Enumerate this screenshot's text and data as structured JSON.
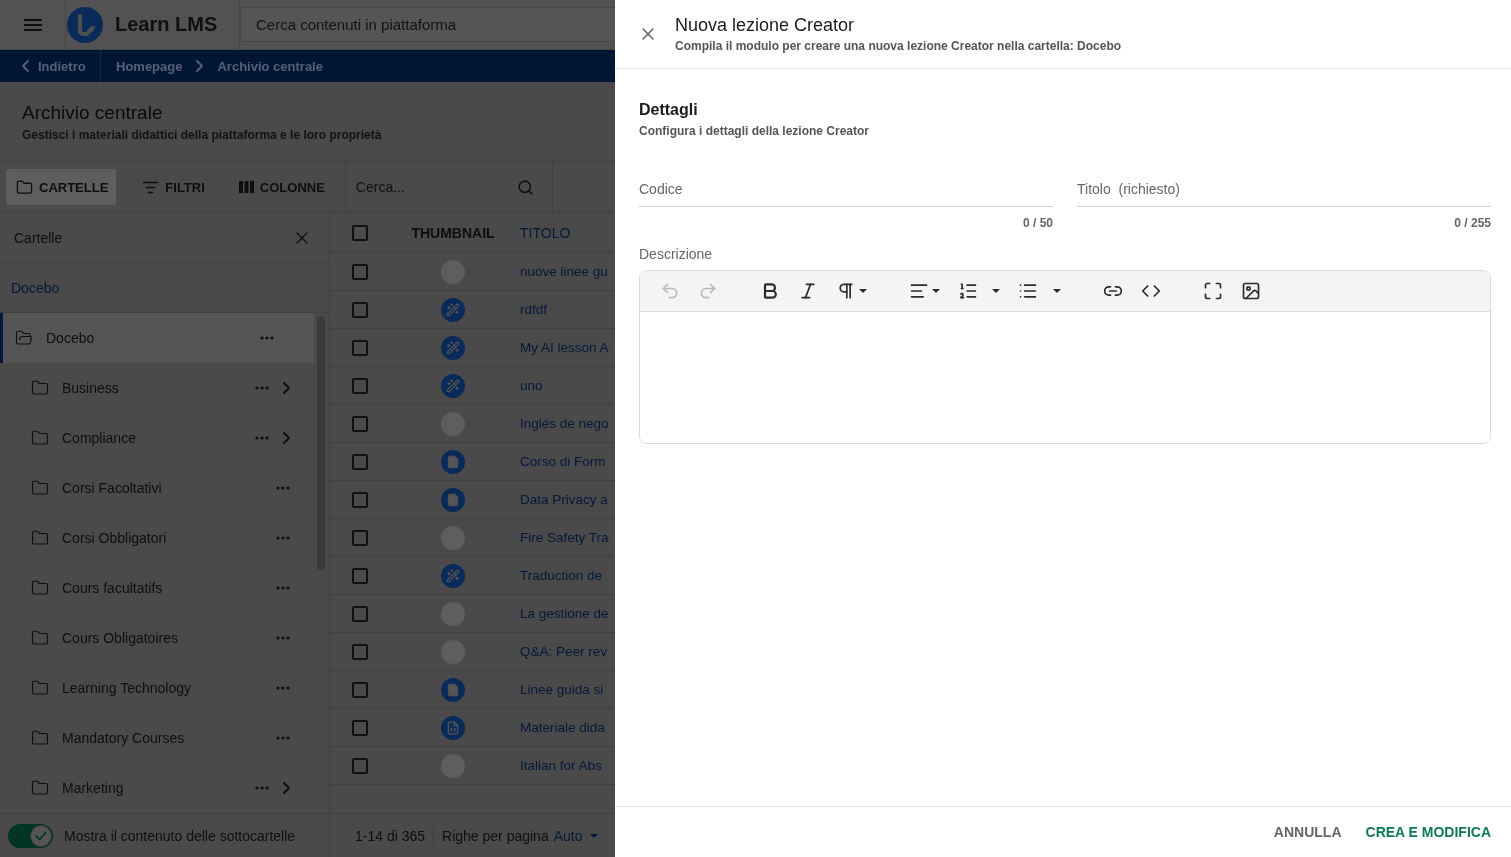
{
  "header": {
    "brand": "Learn LMS",
    "search": {
      "placeholder": "Cerca contenuti in piattaforma"
    }
  },
  "breadcrumb": {
    "back": "Indietro",
    "items": [
      "Homepage",
      "Archivio centrale"
    ]
  },
  "page": {
    "title": "Archivio centrale",
    "subtitle": "Gestisci i materiali didattici della piattaforma e le loro proprietà"
  },
  "toolbar": {
    "buttons": [
      {
        "kind": "folders",
        "label": "CARTELLE",
        "selected": true
      },
      {
        "kind": "filters",
        "label": "FILTRI",
        "selected": false
      },
      {
        "kind": "columns",
        "label": "COLONNE",
        "selected": false
      }
    ],
    "search": {
      "placeholder": "Cerca..."
    }
  },
  "folders": {
    "title": "Cartelle",
    "path": "Docebo",
    "tree": [
      {
        "name": "Docebo",
        "selected": true,
        "expanded": true,
        "children": [
          {
            "name": "Business",
            "selected": false,
            "expanded": false,
            "has_subfolders": true
          },
          {
            "name": "Compliance",
            "selected": false,
            "expanded": false,
            "has_subfolders": true
          },
          {
            "name": "Corsi Facoltativi",
            "selected": false,
            "expanded": false,
            "has_subfolders": false
          },
          {
            "name": "Corsi Obbligatori",
            "selected": false,
            "expanded": false,
            "has_subfolders": false
          },
          {
            "name": "Cours facultatifs",
            "selected": false,
            "expanded": false,
            "has_subfolders": false
          },
          {
            "name": "Cours Obligatoires",
            "selected": false,
            "expanded": false,
            "has_subfolders": false
          },
          {
            "name": "Learning Technology",
            "selected": false,
            "expanded": false,
            "has_subfolders": false
          },
          {
            "name": "Mandatory Courses",
            "selected": false,
            "expanded": false,
            "has_subfolders": false
          },
          {
            "name": "Marketing",
            "selected": false,
            "expanded": false,
            "has_subfolders": true
          }
        ]
      }
    ],
    "toggle": {
      "label": "Mostra il contenuto delle sottocartelle",
      "on": true
    }
  },
  "table": {
    "select_all": {
      "checked": false
    },
    "columns": [
      {
        "label": "THUMBNAIL",
        "sorted": false
      },
      {
        "label": "TITOLO",
        "sorted": true
      }
    ],
    "rows": [
      {
        "kind": "photo",
        "title": "nuove linee gu",
        "checked": false
      },
      {
        "kind": "ai",
        "title": "rdfdf",
        "checked": false
      },
      {
        "kind": "ai",
        "title": "My AI lesson A",
        "checked": false
      },
      {
        "kind": "ai",
        "title": "uno",
        "checked": false
      },
      {
        "kind": "photo",
        "title": "Inglés de nego",
        "checked": false
      },
      {
        "kind": "document",
        "title": "Corso di Form",
        "checked": false
      },
      {
        "kind": "document",
        "title": "Data Privacy a",
        "checked": false
      },
      {
        "kind": "photo",
        "title": "Fire Safety Tra",
        "checked": false
      },
      {
        "kind": "ai",
        "title": "Traduction de",
        "checked": false
      },
      {
        "kind": "photo",
        "title": "La gestione de",
        "checked": false
      },
      {
        "kind": "photo",
        "title": "Q&A: Peer rev",
        "checked": false
      },
      {
        "kind": "document",
        "title": "Linee guida si",
        "checked": false
      },
      {
        "kind": "code_document",
        "title": "Materiale dida",
        "checked": false
      },
      {
        "kind": "photo",
        "title": "Italian for Abs",
        "checked": false
      }
    ]
  },
  "pagination": {
    "range": "1-14 di 365",
    "rows_label": "Righe per pagina",
    "rows_value": "Auto"
  },
  "drawer": {
    "title": "Nuova lezione Creator",
    "subtitle": "Compila il modulo per creare una nuova lezione Creator nella cartella: Docebo",
    "section": {
      "title": "Dettagli",
      "subtitle": "Configura i dettagli della lezione Creator"
    },
    "fields": [
      {
        "label": "Codice",
        "counter": "0 / 50"
      },
      {
        "label": "Titolo",
        "note": "(richiesto)",
        "counter": "0 / 255"
      }
    ],
    "description": {
      "label": "Descrizione",
      "groups": [
        {
          "buttons": [
            {
              "kind": "undo",
              "disabled": true,
              "dropdown": false
            },
            {
              "kind": "redo",
              "disabled": true,
              "dropdown": false
            }
          ]
        },
        {
          "buttons": [
            {
              "kind": "bold",
              "disabled": false,
              "dropdown": false
            },
            {
              "kind": "italic",
              "disabled": false,
              "dropdown": false
            },
            {
              "kind": "paragraph",
              "disabled": false,
              "dropdown": true
            }
          ]
        },
        {
          "buttons": [
            {
              "kind": "align",
              "disabled": false,
              "dropdown": true
            },
            {
              "kind": "ordered_list",
              "disabled": false,
              "dropdown": true
            },
            {
              "kind": "bullet_list",
              "disabled": false,
              "dropdown": true
            }
          ]
        },
        {
          "buttons": [
            {
              "kind": "link",
              "disabled": false,
              "dropdown": false
            },
            {
              "kind": "code",
              "disabled": false,
              "dropdown": false
            }
          ]
        },
        {
          "buttons": [
            {
              "kind": "fullscreen",
              "disabled": false,
              "dropdown": false
            },
            {
              "kind": "image",
              "disabled": false,
              "dropdown": false
            }
          ]
        }
      ]
    },
    "actions": [
      {
        "kind": "secondary",
        "label": "ANNULLA"
      },
      {
        "kind": "primary",
        "label": "CREA E MODIFICA"
      }
    ]
  }
}
